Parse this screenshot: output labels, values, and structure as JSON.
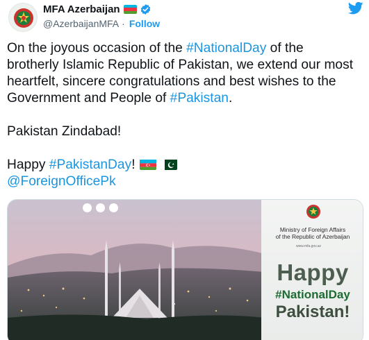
{
  "account": {
    "display_name": "MFA Azerbaijan",
    "handle": "@AzerbaijanMFA",
    "separator": "·",
    "follow_label": "Follow"
  },
  "tweet": {
    "line1_pre": "On the joyous occasion of the ",
    "line1_tag": "#NationalDay",
    "line1_post": " of the",
    "line2": "brotherly Islamic Republic of Pakistan, we extend our most",
    "line3": "heartfelt, sincere congratulations and best wishes to the",
    "line4_pre": "Government and People of ",
    "line4_tag": "#Pakistan",
    "line4_post": ".",
    "line5": "Pakistan Zindabad!",
    "line6_pre": "Happy ",
    "line6_tag": "#PakistanDay",
    "line6_post": "!",
    "mention": "@ForeignOfficePk"
  },
  "media": {
    "ministry_line1": "Ministry of Foreign Affairs",
    "ministry_line2": "of the Republic of Azerbaijan",
    "website": "www.mfa.gov.az",
    "happy": "Happy",
    "hashtag": "#NationalDay",
    "country": "Pakistan!"
  },
  "colors": {
    "link": "#1b95e0",
    "verified": "#1d9bf0",
    "twitter_bird": "#1d9bf0",
    "pk_green": "#01411c",
    "az_blue": "#00b5e2",
    "az_red": "#ef3340",
    "az_green": "#509e2f"
  },
  "icons": [
    "twitter-bird-icon",
    "verified-badge-icon",
    "azerbaijan-flag-icon",
    "pakistan-flag-icon",
    "mfa-emblem-icon"
  ]
}
